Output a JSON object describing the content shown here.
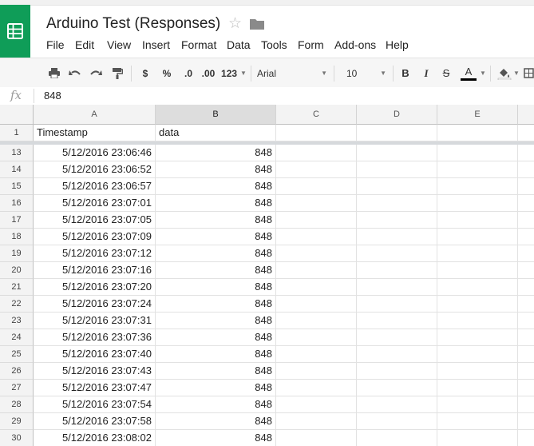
{
  "app": {
    "title": "Arduino Test (Responses)",
    "brand_color": "#0f9d58"
  },
  "menu": [
    "File",
    "Edit",
    "View",
    "Insert",
    "Format",
    "Data",
    "Tools",
    "Form",
    "Add-ons",
    "Help"
  ],
  "toolbar": {
    "currency": "$",
    "percent": "%",
    "decrease_decimals": ".0",
    "increase_decimals": ".00",
    "more_formats": "123",
    "font": "Arial",
    "font_size": "10",
    "bold": "B",
    "italic": "I",
    "strike": "S",
    "text_color": "A"
  },
  "formula_bar": {
    "fx": "fx",
    "value": "848"
  },
  "columns": [
    "A",
    "B",
    "C",
    "D",
    "E"
  ],
  "header_row": {
    "number": "1",
    "a": "Timestamp",
    "b": "data"
  },
  "rows": [
    {
      "n": "13",
      "a": "5/12/2016 23:06:46",
      "b": "848"
    },
    {
      "n": "14",
      "a": "5/12/2016 23:06:52",
      "b": "848"
    },
    {
      "n": "15",
      "a": "5/12/2016 23:06:57",
      "b": "848"
    },
    {
      "n": "16",
      "a": "5/12/2016 23:07:01",
      "b": "848"
    },
    {
      "n": "17",
      "a": "5/12/2016 23:07:05",
      "b": "848"
    },
    {
      "n": "18",
      "a": "5/12/2016 23:07:09",
      "b": "848"
    },
    {
      "n": "19",
      "a": "5/12/2016 23:07:12",
      "b": "848"
    },
    {
      "n": "20",
      "a": "5/12/2016 23:07:16",
      "b": "848"
    },
    {
      "n": "21",
      "a": "5/12/2016 23:07:20",
      "b": "848"
    },
    {
      "n": "22",
      "a": "5/12/2016 23:07:24",
      "b": "848"
    },
    {
      "n": "23",
      "a": "5/12/2016 23:07:31",
      "b": "848"
    },
    {
      "n": "24",
      "a": "5/12/2016 23:07:36",
      "b": "848"
    },
    {
      "n": "25",
      "a": "5/12/2016 23:07:40",
      "b": "848"
    },
    {
      "n": "26",
      "a": "5/12/2016 23:07:43",
      "b": "848"
    },
    {
      "n": "27",
      "a": "5/12/2016 23:07:47",
      "b": "848"
    },
    {
      "n": "28",
      "a": "5/12/2016 23:07:54",
      "b": "848"
    },
    {
      "n": "29",
      "a": "5/12/2016 23:07:58",
      "b": "848"
    },
    {
      "n": "30",
      "a": "5/12/2016 23:08:02",
      "b": "848"
    }
  ]
}
